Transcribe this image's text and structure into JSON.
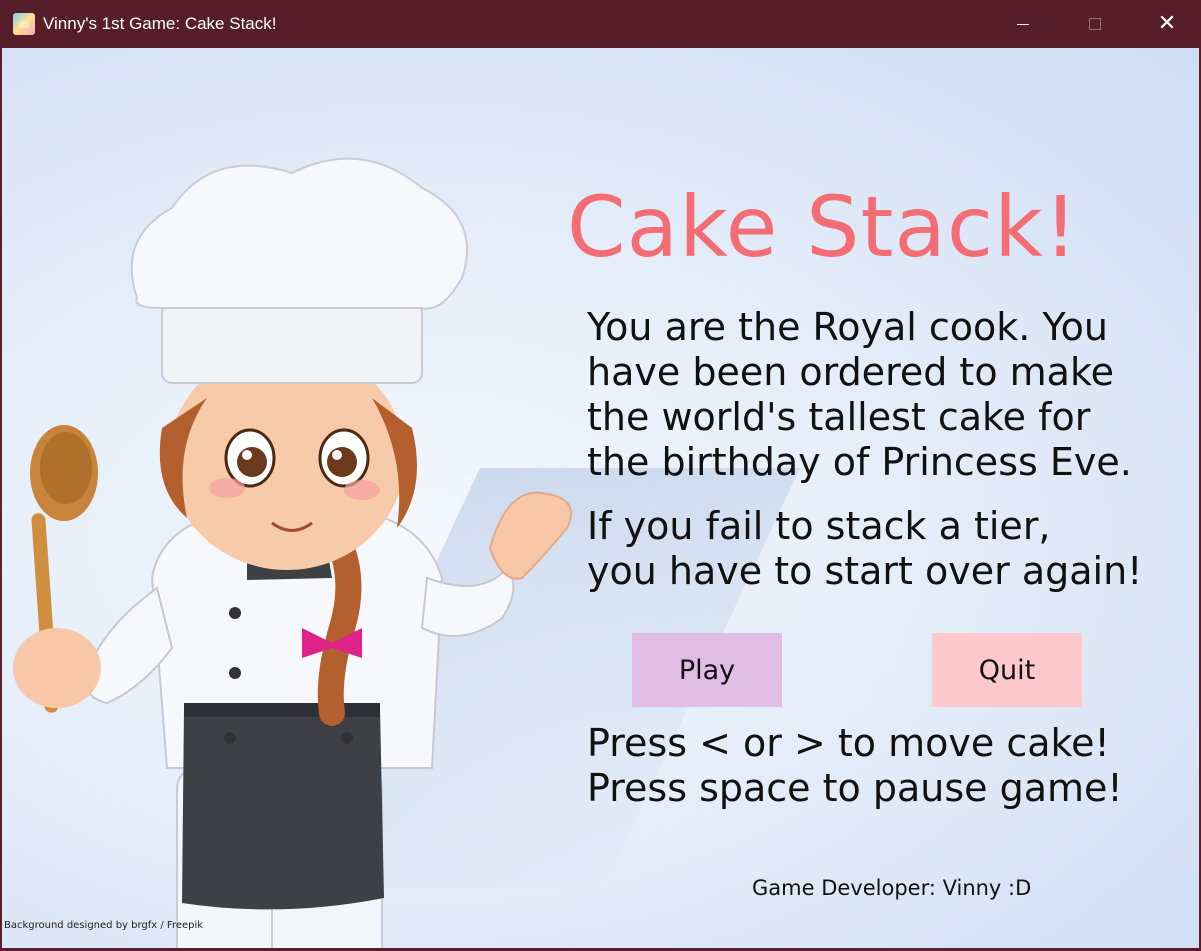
{
  "window": {
    "title": "Vinny's 1st Game: Cake Stack!",
    "controls": [
      "minimize",
      "maximize",
      "close"
    ]
  },
  "game": {
    "heading": "Cake Stack!",
    "story_lines": [
      "You are the Royal cook. You",
      "have been ordered to make",
      "the world's tallest cake for",
      "the birthday of Princess Eve."
    ],
    "warning_lines": [
      "If you fail to stack a tier,",
      "you have to start over again!"
    ],
    "buttons": {
      "play": "Play",
      "quit": "Quit"
    },
    "controls_lines": [
      "Press < or > to move cake!",
      "Press space to pause game!"
    ],
    "developer": "Game Developer: Vinny :D",
    "credit": "Background designed by brgfx / Freepik"
  },
  "colors": {
    "titlebar": "#561d2b",
    "heading": "#f46d74",
    "play_button": "#e1bde6",
    "quit_button": "#fec9cb",
    "background": "#e4edf9"
  },
  "icons": {
    "app": "cake-icon",
    "close": "close-icon",
    "maximize": "maximize-icon",
    "minimize": "minimize-icon"
  }
}
